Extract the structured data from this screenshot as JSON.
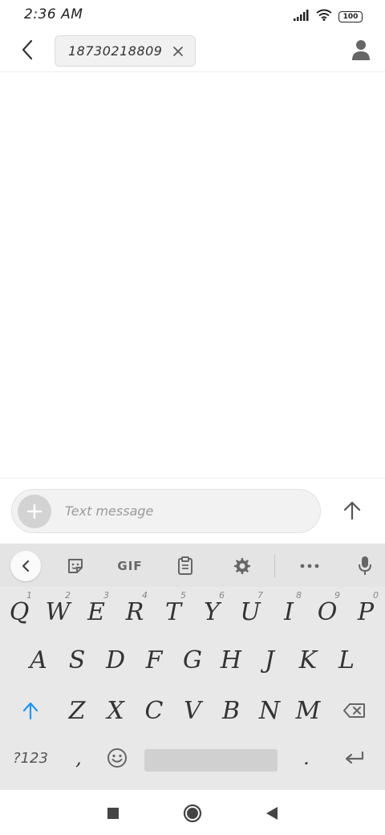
{
  "status_bar": {
    "time": "2:36 AM",
    "battery": "100",
    "icons": [
      "signal-icon",
      "wifi-icon",
      "battery-icon"
    ]
  },
  "header": {
    "recipient": "18730218809",
    "icons": [
      "back-arrow-icon",
      "close-icon",
      "contact-icon"
    ]
  },
  "compose": {
    "placeholder": "Text message",
    "icons": [
      "plus-icon",
      "send-arrow-icon"
    ]
  },
  "keyboard": {
    "toolbar": {
      "gif_label": "GIF",
      "icons": [
        "collapse-chevron-icon",
        "sticker-icon",
        "clipboard-icon",
        "gear-icon",
        "more-icon",
        "microphone-icon"
      ]
    },
    "rows": [
      [
        {
          "label": "Q",
          "hint": "1"
        },
        {
          "label": "W",
          "hint": "2"
        },
        {
          "label": "E",
          "hint": "3"
        },
        {
          "label": "R",
          "hint": "4"
        },
        {
          "label": "T",
          "hint": "5"
        },
        {
          "label": "Y",
          "hint": "6"
        },
        {
          "label": "U",
          "hint": "7"
        },
        {
          "label": "I",
          "hint": "8"
        },
        {
          "label": "O",
          "hint": "9"
        },
        {
          "label": "P",
          "hint": "0"
        }
      ],
      [
        {
          "label": "A"
        },
        {
          "label": "S"
        },
        {
          "label": "D"
        },
        {
          "label": "F"
        },
        {
          "label": "G"
        },
        {
          "label": "H"
        },
        {
          "label": "J"
        },
        {
          "label": "K"
        },
        {
          "label": "L"
        }
      ],
      [
        {
          "label": "Z"
        },
        {
          "label": "X"
        },
        {
          "label": "C"
        },
        {
          "label": "V"
        },
        {
          "label": "B"
        },
        {
          "label": "N"
        },
        {
          "label": "M"
        }
      ]
    ],
    "bottom_row": {
      "symbols_label": "?123",
      "comma_label": ",",
      "period_label": "."
    },
    "colors": {
      "shift_accent": "#2196f3",
      "background": "#e8e8e8"
    }
  },
  "nav_bar": {
    "icons": [
      "recents-square-icon",
      "home-circle-icon",
      "back-triangle-icon"
    ]
  }
}
